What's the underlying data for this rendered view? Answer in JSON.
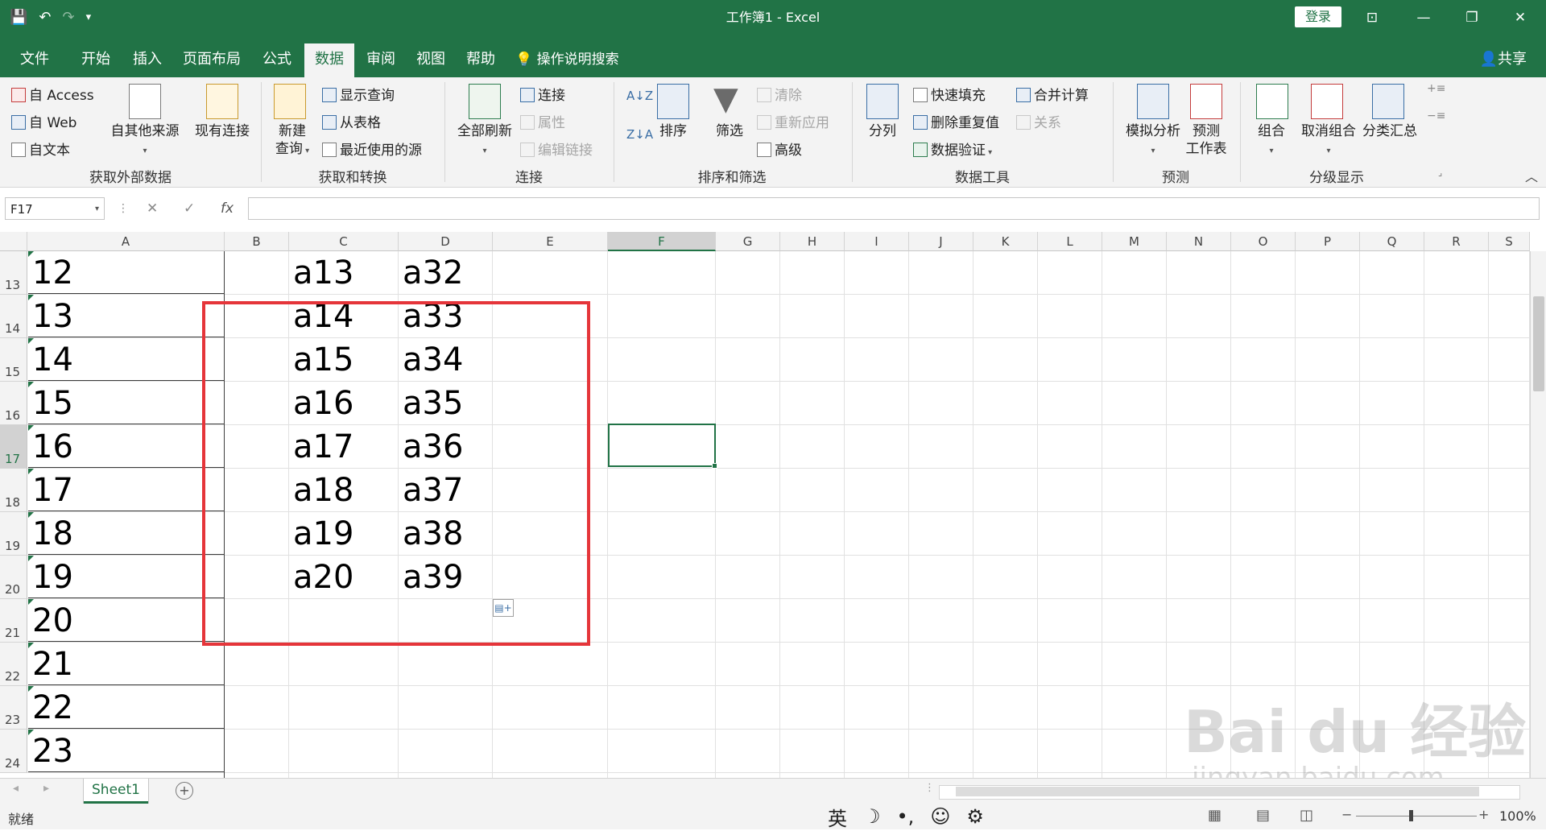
{
  "window": {
    "title": "工作簿1  -  Excel",
    "login": "登录"
  },
  "tabs": [
    {
      "label": "文件"
    },
    {
      "label": "开始"
    },
    {
      "label": "插入"
    },
    {
      "label": "页面布局"
    },
    {
      "label": "公式"
    },
    {
      "label": "数据",
      "active": true
    },
    {
      "label": "审阅"
    },
    {
      "label": "视图"
    },
    {
      "label": "帮助"
    }
  ],
  "tell_me": "操作说明搜索",
  "share": "共享",
  "ribbon": {
    "get_external": {
      "label": "获取外部数据",
      "access": "自 Access",
      "web": "自 Web",
      "text": "自文本",
      "other": "自其他来源",
      "existing": "现有连接"
    },
    "transform": {
      "label": "获取和转换",
      "new_query_1": "新建",
      "new_query_2": "查询",
      "show_queries": "显示查询",
      "from_table": "从表格",
      "recent_sources": "最近使用的源"
    },
    "connections": {
      "label": "连接",
      "refresh_all": "全部刷新",
      "connections": "连接",
      "properties": "属性",
      "edit_links": "编辑链接"
    },
    "sort_filter": {
      "label": "排序和筛选",
      "sort": "排序",
      "filter": "筛选",
      "clear": "清除",
      "reapply": "重新应用",
      "advanced": "高级"
    },
    "data_tools": {
      "label": "数据工具",
      "text_to_columns": "分列",
      "flash_fill": "快速填充",
      "remove_dup": "删除重复值",
      "validation": "数据验证",
      "consolidate": "合并计算",
      "relationships": "关系"
    },
    "forecast": {
      "label": "预测",
      "what_if": "模拟分析",
      "forecast_1": "预测",
      "forecast_2": "工作表"
    },
    "outline": {
      "label": "分级显示",
      "group": "组合",
      "ungroup": "取消组合",
      "subtotal": "分类汇总"
    }
  },
  "formula_bar": {
    "name_box": "F17",
    "fx": "fx",
    "content": ""
  },
  "columns": [
    "A",
    "B",
    "C",
    "D",
    "E",
    "F",
    "G",
    "H",
    "I",
    "J",
    "K",
    "L",
    "M",
    "N",
    "O",
    "P",
    "Q",
    "R",
    "S"
  ],
  "rows": [
    {
      "num": "13",
      "a": "12",
      "c": "a13",
      "d": "a32"
    },
    {
      "num": "14",
      "a": "13",
      "c": "a14",
      "d": "a33"
    },
    {
      "num": "15",
      "a": "14",
      "c": "a15",
      "d": "a34"
    },
    {
      "num": "16",
      "a": "15",
      "c": "a16",
      "d": "a35"
    },
    {
      "num": "17",
      "a": "16",
      "c": "a17",
      "d": "a36"
    },
    {
      "num": "18",
      "a": "17",
      "c": "a18",
      "d": "a37"
    },
    {
      "num": "19",
      "a": "18",
      "c": "a19",
      "d": "a38"
    },
    {
      "num": "20",
      "a": "19",
      "c": "a20",
      "d": "a39"
    },
    {
      "num": "21",
      "a": "20",
      "c": "",
      "d": ""
    },
    {
      "num": "22",
      "a": "21",
      "c": "",
      "d": ""
    },
    {
      "num": "23",
      "a": "22",
      "c": "",
      "d": ""
    },
    {
      "num": "24",
      "a": "23",
      "c": "",
      "d": ""
    }
  ],
  "selected_cell": "F17",
  "sheet": {
    "tab": "Sheet1"
  },
  "status": {
    "ready": "就绪",
    "ime": [
      "英",
      "☽",
      "•,",
      "☺",
      "⚙"
    ],
    "zoom": "100%"
  },
  "watermark": {
    "main": "Bai du 经验",
    "url": "jingyan.baidu.com"
  },
  "colors": {
    "accent": "#217346",
    "highlight_box": "#e5353a"
  }
}
